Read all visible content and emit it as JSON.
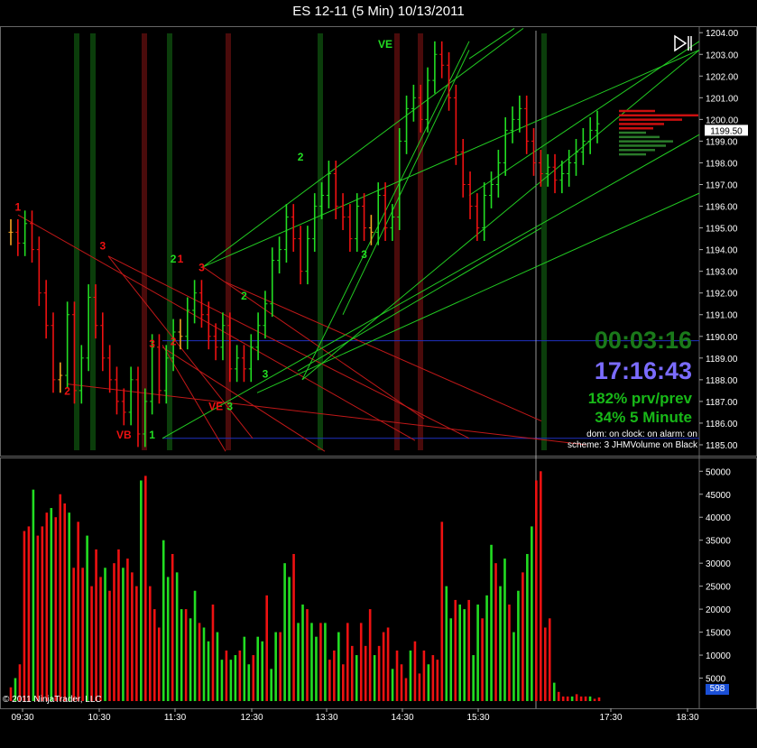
{
  "window": {
    "title": "ES 12-11 (5 Min)  10/13/2011"
  },
  "overlay": {
    "countdown": "00:03:16",
    "clock": "17:16:43",
    "stat_prev": "182% prv/prev",
    "stat_5min": "34% 5 Minute",
    "info_line1": "dom: on clock: on alarm: on",
    "info_line2": "scheme: 3 JHMVolume on Black",
    "copyright": "© 2011 NinjaTrader, LLC",
    "volume_tag": "598",
    "price_tag": "1199.50"
  },
  "colors": {
    "up": "#22dd22",
    "down": "#ee1111",
    "neutral": "#f5a623",
    "grid": "#2a2a2a",
    "axis_text": "#ffffff"
  },
  "chart_data": [
    {
      "type": "line",
      "title": "ES 12-11 (5 Min)  10/13/2011",
      "x_tick_labels": [
        "09:30",
        "10:30",
        "11:30",
        "12:30",
        "13:30",
        "14:30",
        "15:30",
        "17:30",
        "18:30"
      ],
      "y_tick_labels": [
        "1185.00",
        "1186.00",
        "1187.00",
        "1188.00",
        "1189.00",
        "1190.00",
        "1191.00",
        "1192.00",
        "1193.00",
        "1194.00",
        "1195.00",
        "1196.00",
        "1197.00",
        "1198.00",
        "1199.00",
        "1200.00",
        "1201.00",
        "1202.00",
        "1203.00",
        "1204.00"
      ],
      "ylim": [
        1184.5,
        1204.3
      ],
      "last_price": 1199.5,
      "closes": [
        1194.8,
        1194.3,
        1195.2,
        1194.0,
        1192.0,
        1190.5,
        1188.0,
        1188.2,
        1191.0,
        1187.5,
        1189.0,
        1191.8,
        1190.5,
        1189.0,
        1188.0,
        1187.0,
        1186.5,
        1188.0,
        1185.5,
        1187.0,
        1189.5,
        1187.5,
        1189.0,
        1190.2,
        1190.0,
        1191.2,
        1192.0,
        1191.0,
        1190.0,
        1189.5,
        1190.5,
        1188.5,
        1189.0,
        1188.5,
        1189.5,
        1190.5,
        1191.5,
        1193.5,
        1194.0,
        1195.5,
        1194.5,
        1193.0,
        1194.5,
        1196.0,
        1196.5,
        1197.5,
        1196.0,
        1195.5,
        1194.5,
        1196.0,
        1195.0,
        1194.8,
        1196.5,
        1195.0,
        1195.5,
        1199.0,
        1200.5,
        1201.0,
        1200.0,
        1201.8,
        1203.0,
        1202.5,
        1201.0,
        1198.5,
        1197.0,
        1196.0,
        1195.0,
        1196.5,
        1197.0,
        1198.0,
        1199.5,
        1200.0,
        1200.5,
        1199.0,
        1198.0,
        1197.5,
        1197.8,
        1197.2,
        1197.5,
        1198.0,
        1198.5,
        1199.0,
        1199.5,
        1199.8
      ],
      "highs_lows_note": "",
      "annotations": [
        {
          "label": "1",
          "price": 1195.8,
          "bar": 1,
          "color": "down"
        },
        {
          "label": "3",
          "price": 1194.0,
          "bar": 13,
          "color": "down"
        },
        {
          "label": "2",
          "price": 1187.3,
          "bar": 8,
          "color": "down"
        },
        {
          "label": "VB",
          "price": 1185.3,
          "bar": 16,
          "color": "down"
        },
        {
          "label": "3",
          "price": 1189.5,
          "bar": 20,
          "color": "down"
        },
        {
          "label": "1",
          "price": 1185.3,
          "bar": 20,
          "color": "up"
        },
        {
          "label": "2",
          "price": 1193.4,
          "bar": 23,
          "color": "up"
        },
        {
          "label": "1",
          "price": 1193.4,
          "bar": 24,
          "color": "down"
        },
        {
          "label": "3",
          "price": 1193.0,
          "bar": 27,
          "color": "down"
        },
        {
          "label": "2",
          "price": 1189.6,
          "bar": 23,
          "color": "down"
        },
        {
          "label": "VE",
          "price": 1186.6,
          "bar": 29,
          "color": "down"
        },
        {
          "label": "3",
          "price": 1186.6,
          "bar": 31,
          "color": "up"
        },
        {
          "label": "2",
          "price": 1191.7,
          "bar": 33,
          "color": "up"
        },
        {
          "label": "3",
          "price": 1188.1,
          "bar": 36,
          "color": "up"
        },
        {
          "label": "2",
          "price": 1198.1,
          "bar": 41,
          "color": "up"
        },
        {
          "label": "3",
          "price": 1193.6,
          "bar": 50,
          "color": "up"
        },
        {
          "label": "VE",
          "price": 1203.3,
          "bar": 53,
          "color": "up"
        }
      ]
    },
    {
      "type": "bar",
      "title": "Volume",
      "y_tick_labels": [
        "5000",
        "10000",
        "15000",
        "20000",
        "25000",
        "30000",
        "35000",
        "40000",
        "45000",
        "50000"
      ],
      "ylim": [
        0,
        53000
      ],
      "values": [
        3000,
        5000,
        8000,
        37000,
        38000,
        46000,
        36000,
        38000,
        41000,
        42000,
        40000,
        45000,
        43000,
        41000,
        29000,
        39000,
        29000,
        36000,
        25000,
        33000,
        27000,
        29000,
        24000,
        30000,
        33000,
        29000,
        31000,
        28000,
        25000,
        48000,
        49000,
        25000,
        20000,
        16000,
        35000,
        27000,
        32000,
        28000,
        20000,
        20000,
        18000,
        24000,
        17000,
        16000,
        13000,
        21000,
        15000,
        9000,
        11000,
        9000,
        10000,
        11000,
        14000,
        8000,
        10000,
        14000,
        13000,
        23000,
        7000,
        15000,
        15000,
        30000,
        27000,
        32000,
        17000,
        21000,
        20000,
        17000,
        14000,
        17000,
        17000,
        9000,
        11000,
        15000,
        8000,
        17000,
        12000,
        10000,
        17000,
        12000,
        20000,
        10000,
        12000,
        15000,
        16000,
        7000,
        11000,
        8000,
        5000,
        11000,
        13000,
        6000,
        11000,
        8000,
        10000,
        9000,
        39000,
        25000,
        18000,
        22000,
        21000,
        20000,
        22000,
        10000,
        21000,
        18000,
        23000,
        34000,
        30000,
        25000,
        31000,
        21000,
        15000,
        24000,
        28000,
        32000,
        38000,
        48000,
        50000,
        16000,
        18000,
        4000,
        2000,
        1000,
        1000,
        1000,
        1500,
        1000,
        1000,
        1000,
        500,
        800
      ],
      "colors_note": ""
    }
  ]
}
